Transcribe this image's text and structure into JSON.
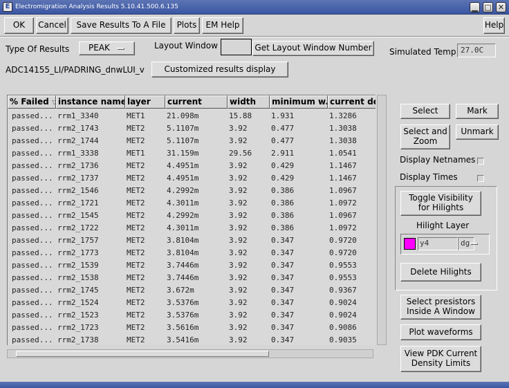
{
  "window": {
    "title": "Electromigration Analysis Results 5.10.41.500.6.135",
    "title_icon": "app-icon",
    "controls": [
      "minimize-icon",
      "maximize-icon",
      "close-icon"
    ]
  },
  "menu": {
    "ok": "OK",
    "cancel": "Cancel",
    "save": "Save Results To A File",
    "plots": "Plots",
    "em_help": "EM Help",
    "help": "Help"
  },
  "options": {
    "type_label": "Type Of Results",
    "type_value": "PEAK",
    "layout_window_label": "Layout Window",
    "layout_window_value": "",
    "get_layout_button": "Get Layout Window Number",
    "sim_temp_label": "Simulated Temp",
    "sim_temp_value": "27.0C",
    "cell_path": "ADC14155_LI/PADRING_dnwLUI_v",
    "customized_button": "Customized results display"
  },
  "table": {
    "columns": [
      "% Failed",
      "instance name",
      "layer",
      "current",
      "width",
      "minimum w...",
      "current der"
    ],
    "sort_indicator": "sort-descending-icon",
    "rows": [
      [
        "passed...",
        "rrm1_3340",
        "MET1",
        "21.098m",
        "15.88",
        "1.931",
        "1.3286"
      ],
      [
        "passed...",
        "rrm2_1743",
        "MET2",
        "5.1107m",
        "3.92",
        "0.477",
        "1.3038"
      ],
      [
        "passed...",
        "rrm2_1744",
        "MET2",
        "5.1107m",
        "3.92",
        "0.477",
        "1.3038"
      ],
      [
        "passed...",
        "rrm1_3338",
        "MET1",
        "31.159m",
        "29.56",
        "2.911",
        "1.0541"
      ],
      [
        "passed...",
        "rrm2_1736",
        "MET2",
        "4.4951m",
        "3.92",
        "0.429",
        "1.1467"
      ],
      [
        "passed...",
        "rrm2_1737",
        "MET2",
        "4.4951m",
        "3.92",
        "0.429",
        "1.1467"
      ],
      [
        "passed...",
        "rrm2_1546",
        "MET2",
        "4.2992m",
        "3.92",
        "0.386",
        "1.0967"
      ],
      [
        "passed...",
        "rrm2_1721",
        "MET2",
        "4.3011m",
        "3.92",
        "0.386",
        "1.0972"
      ],
      [
        "passed...",
        "rrm2_1545",
        "MET2",
        "4.2992m",
        "3.92",
        "0.386",
        "1.0967"
      ],
      [
        "passed...",
        "rrm2_1722",
        "MET2",
        "4.3011m",
        "3.92",
        "0.386",
        "1.0972"
      ],
      [
        "passed...",
        "rrm2_1757",
        "MET2",
        "3.8104m",
        "3.92",
        "0.347",
        "0.9720"
      ],
      [
        "passed...",
        "rrm2_1773",
        "MET2",
        "3.8104m",
        "3.92",
        "0.347",
        "0.9720"
      ],
      [
        "passed...",
        "rrm2_1539",
        "MET2",
        "3.7446m",
        "3.92",
        "0.347",
        "0.9553"
      ],
      [
        "passed...",
        "rrm2_1538",
        "MET2",
        "3.7446m",
        "3.92",
        "0.347",
        "0.9553"
      ],
      [
        "passed...",
        "rrm2_1745",
        "MET2",
        "3.672m",
        "3.92",
        "0.347",
        "0.9367"
      ],
      [
        "passed...",
        "rrm2_1524",
        "MET2",
        "3.5376m",
        "3.92",
        "0.347",
        "0.9024"
      ],
      [
        "passed...",
        "rrm2_1523",
        "MET2",
        "3.5376m",
        "3.92",
        "0.347",
        "0.9024"
      ],
      [
        "passed...",
        "rrm2_1723",
        "MET2",
        "3.5616m",
        "3.92",
        "0.347",
        "0.9086"
      ],
      [
        "passed...",
        "rrm2_1738",
        "MET2",
        "3.5416m",
        "3.92",
        "0.347",
        "0.9035"
      ]
    ]
  },
  "right_panel": {
    "select": "Select",
    "mark": "Mark",
    "select_zoom": "Select and Zoom",
    "unmark": "Unmark",
    "display_netnames": "Display Netnames",
    "display_times": "Display Times",
    "toggle_visibility": "Toggle Visibility for Hilights",
    "hilight_layer_label": "Hilight Layer",
    "hilight_layer_name": "y4",
    "hilight_layer_purpose": "dg",
    "hilight_color": "#ff00ff",
    "delete_hilights": "Delete Hilights",
    "select_presistors": "Select presistors Inside A Window",
    "plot_waveforms": "Plot waveforms",
    "view_pdk": "View PDK Current Density Limits"
  }
}
